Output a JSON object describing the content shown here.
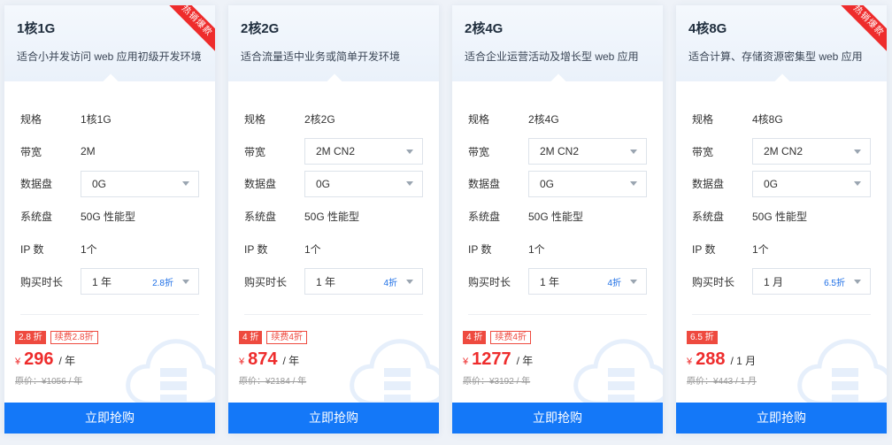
{
  "colors": {
    "primary": "#1478f8",
    "price_red": "#ee2c2c",
    "tag_red": "#ee4a3f"
  },
  "cards": [
    {
      "title": "1核1G",
      "desc": "适合小并发访问 web 应用初级开发环境",
      "ribbon": "热销爆款",
      "specs": {
        "spec_label": "规格",
        "spec_value": "1核1G",
        "bw_label": "带宽",
        "bw_value": "2M",
        "disk_label": "数据盘",
        "disk_value": "0G",
        "sys_label": "系统盘",
        "sys_value": "50G 性能型",
        "ip_label": "IP 数",
        "ip_value": "1个",
        "dur_label": "购买时长",
        "dur_value": "1 年",
        "dur_discount": "2.8折"
      },
      "tag_discount": "2.8 折",
      "tag_renew": "续费2.8折",
      "currency": "¥",
      "price": "296",
      "unit": "/ 年",
      "original": "原价：¥1056 / 年",
      "buy": "立即抢购"
    },
    {
      "title": "2核2G",
      "desc": "适合流量适中业务或简单开发环境",
      "ribbon": "",
      "specs": {
        "spec_label": "规格",
        "spec_value": "2核2G",
        "bw_label": "带宽",
        "bw_value": "2M CN2",
        "disk_label": "数据盘",
        "disk_value": "0G",
        "sys_label": "系统盘",
        "sys_value": "50G 性能型",
        "ip_label": "IP 数",
        "ip_value": "1个",
        "dur_label": "购买时长",
        "dur_value": "1 年",
        "dur_discount": "4折"
      },
      "tag_discount": "4 折",
      "tag_renew": "续费4折",
      "currency": "¥",
      "price": "874",
      "unit": "/ 年",
      "original": "原价：¥2184 / 年",
      "buy": "立即抢购"
    },
    {
      "title": "2核4G",
      "desc": "适合企业运营活动及增长型 web 应用",
      "ribbon": "",
      "specs": {
        "spec_label": "规格",
        "spec_value": "2核4G",
        "bw_label": "带宽",
        "bw_value": "2M CN2",
        "disk_label": "数据盘",
        "disk_value": "0G",
        "sys_label": "系统盘",
        "sys_value": "50G 性能型",
        "ip_label": "IP 数",
        "ip_value": "1个",
        "dur_label": "购买时长",
        "dur_value": "1 年",
        "dur_discount": "4折"
      },
      "tag_discount": "4 折",
      "tag_renew": "续费4折",
      "currency": "¥",
      "price": "1277",
      "unit": "/ 年",
      "original": "原价：¥3192 / 年",
      "buy": "立即抢购"
    },
    {
      "title": "4核8G",
      "desc": "适合计算、存储资源密集型 web 应用",
      "ribbon": "热销爆款",
      "specs": {
        "spec_label": "规格",
        "spec_value": "4核8G",
        "bw_label": "带宽",
        "bw_value": "2M CN2",
        "disk_label": "数据盘",
        "disk_value": "0G",
        "sys_label": "系统盘",
        "sys_value": "50G 性能型",
        "ip_label": "IP 数",
        "ip_value": "1个",
        "dur_label": "购买时长",
        "dur_value": "1 月",
        "dur_discount": "6.5折"
      },
      "tag_discount": "6.5 折",
      "tag_renew": "",
      "currency": "¥",
      "price": "288",
      "unit": "/ 1 月",
      "original": "原价：¥443 / 1 月",
      "buy": "立即抢购"
    }
  ]
}
